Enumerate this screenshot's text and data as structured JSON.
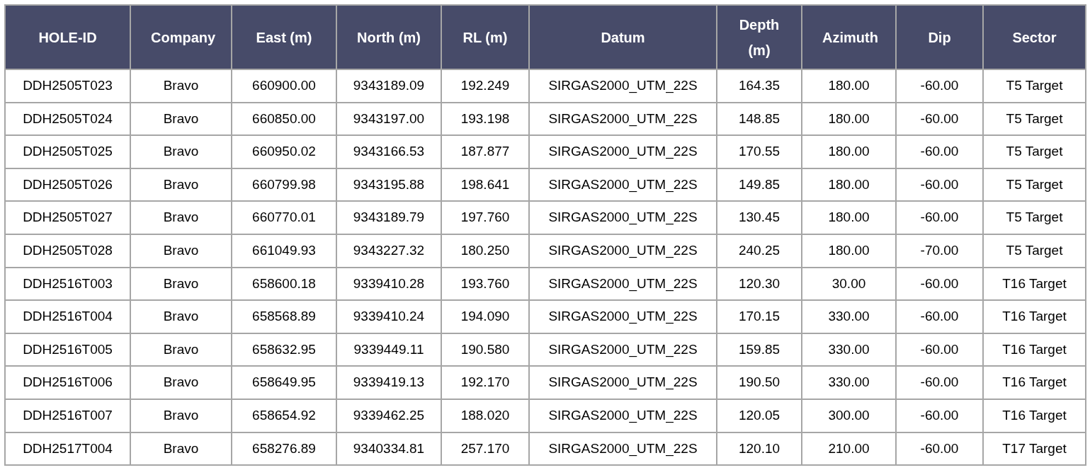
{
  "table": {
    "columns": [
      "HOLE-ID",
      "Company",
      "East (m)",
      "North (m)",
      "RL (m)",
      "Datum",
      "Depth (m)",
      "Azimuth",
      "Dip",
      "Sector"
    ],
    "rows": [
      [
        "DDH2505T023",
        "Bravo",
        "660900.00",
        "9343189.09",
        "192.249",
        "SIRGAS2000_UTM_22S",
        "164.35",
        "180.00",
        "-60.00",
        "T5 Target"
      ],
      [
        "DDH2505T024",
        "Bravo",
        "660850.00",
        "9343197.00",
        "193.198",
        "SIRGAS2000_UTM_22S",
        "148.85",
        "180.00",
        "-60.00",
        "T5 Target"
      ],
      [
        "DDH2505T025",
        "Bravo",
        "660950.02",
        "9343166.53",
        "187.877",
        "SIRGAS2000_UTM_22S",
        "170.55",
        "180.00",
        "-60.00",
        "T5 Target"
      ],
      [
        "DDH2505T026",
        "Bravo",
        "660799.98",
        "9343195.88",
        "198.641",
        "SIRGAS2000_UTM_22S",
        "149.85",
        "180.00",
        "-60.00",
        "T5 Target"
      ],
      [
        "DDH2505T027",
        "Bravo",
        "660770.01",
        "9343189.79",
        "197.760",
        "SIRGAS2000_UTM_22S",
        "130.45",
        "180.00",
        "-60.00",
        "T5 Target"
      ],
      [
        "DDH2505T028",
        "Bravo",
        "661049.93",
        "9343227.32",
        "180.250",
        "SIRGAS2000_UTM_22S",
        "240.25",
        "180.00",
        "-70.00",
        "T5 Target"
      ],
      [
        "DDH2516T003",
        "Bravo",
        "658600.18",
        "9339410.28",
        "193.760",
        "SIRGAS2000_UTM_22S",
        "120.30",
        "30.00",
        "-60.00",
        "T16 Target"
      ],
      [
        "DDH2516T004",
        "Bravo",
        "658568.89",
        "9339410.24",
        "194.090",
        "SIRGAS2000_UTM_22S",
        "170.15",
        "330.00",
        "-60.00",
        "T16 Target"
      ],
      [
        "DDH2516T005",
        "Bravo",
        "658632.95",
        "9339449.11",
        "190.580",
        "SIRGAS2000_UTM_22S",
        "159.85",
        "330.00",
        "-60.00",
        "T16 Target"
      ],
      [
        "DDH2516T006",
        "Bravo",
        "658649.95",
        "9339419.13",
        "192.170",
        "SIRGAS2000_UTM_22S",
        "190.50",
        "330.00",
        "-60.00",
        "T16 Target"
      ],
      [
        "DDH2516T007",
        "Bravo",
        "658654.92",
        "9339462.25",
        "188.020",
        "SIRGAS2000_UTM_22S",
        "120.05",
        "300.00",
        "-60.00",
        "T16 Target"
      ],
      [
        "DDH2517T004",
        "Bravo",
        "658276.89",
        "9340334.81",
        "257.170",
        "SIRGAS2000_UTM_22S",
        "120.10",
        "210.00",
        "-60.00",
        "T17 Target"
      ]
    ]
  }
}
